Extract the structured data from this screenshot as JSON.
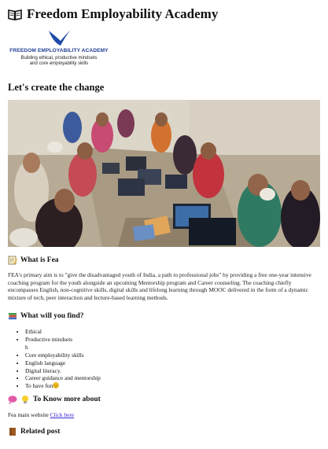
{
  "header": {
    "title": "Freedom Employability Academy"
  },
  "logo": {
    "name": "FREEDOM EMPLOYABILITY ACADEMY",
    "tagline_1": "Building ethical, productive mindsets",
    "tagline_2": "and core employability skills"
  },
  "hero": {
    "title": "Let's create the change",
    "image_icon": "classroom-photo"
  },
  "about": {
    "heading": "What is Fea",
    "icon": "memo-icon",
    "text": "FEA's primary aim is to \"give the disadvantaged youth of India, a path to professional jobs\" by providing a free one-year intensive coaching program for the youth alongside an upcoming Mentorship program and Career counseling. The coaching chiefly encompasses English, non-cognitive skills, digital skills and lifelong learning through MOOC delivered in the form of a dynamic mixture of tech, peer interaction and lecture-based learning methods."
  },
  "find": {
    "heading": "What will you find?",
    "icon": "books-icon",
    "items": [
      "Ethical",
      "Productive mindsets\nh",
      "Core employability skills",
      "English language",
      "Digital literacy.",
      "Career guidance and mentorship",
      "To have fun"
    ],
    "smile_icon": "smiling-face-icon"
  },
  "know_more": {
    "heading": "To Know more about",
    "icons": [
      "speech-bubble-icon",
      "light-bulb-icon"
    ],
    "website_label": "Fea main website",
    "website_link": "Click here"
  },
  "related": {
    "heading": "Related post",
    "icon": "book-icon"
  },
  "colors": {
    "logo_blue": "#1f3e95",
    "link": "#3a2ad0"
  }
}
